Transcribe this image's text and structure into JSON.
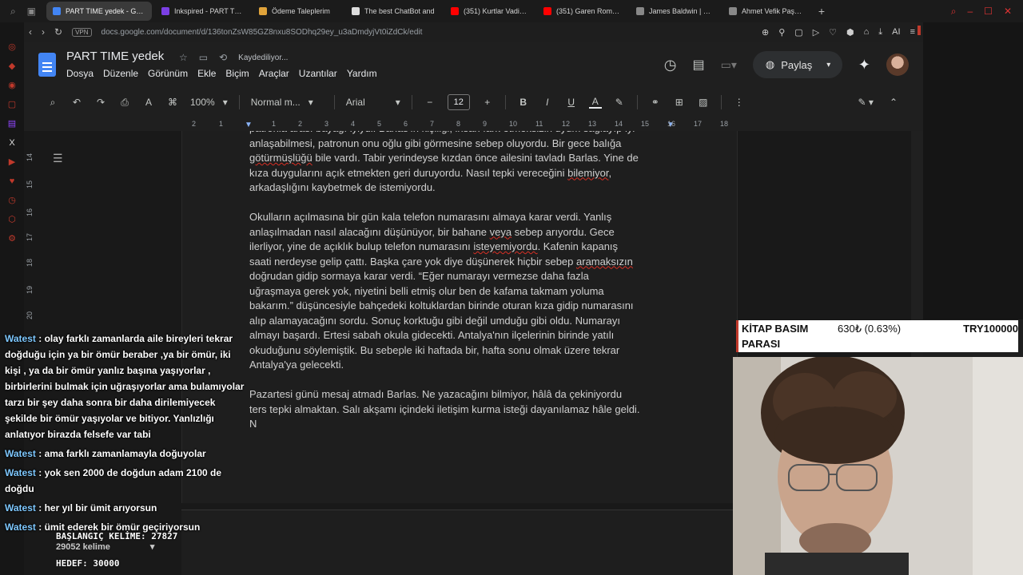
{
  "browser": {
    "tabs": [
      {
        "label": "PART TIME yedek - Google",
        "active": true,
        "color": "#4285f4"
      },
      {
        "label": "Inkspired - PART TIME",
        "active": false,
        "color": "#7b3fe4"
      },
      {
        "label": "Ödeme Taleplerim",
        "active": false,
        "color": "#e0a33a"
      },
      {
        "label": "The best ChatBot and",
        "active": false,
        "color": "#dddddd"
      },
      {
        "label": "(351) Kurtlar Vadisi - 7.",
        "active": false,
        "color": "#ff0000"
      },
      {
        "label": "(351) Garen Romanı İnc",
        "active": false,
        "color": "#ff0000"
      },
      {
        "label": "James Baldwin | Her U",
        "active": false,
        "color": "#888888"
      },
      {
        "label": "Ahmet Vefik Paşa Kütü",
        "active": false,
        "color": "#888888"
      }
    ],
    "new_tab": "+",
    "vpn": "VPN",
    "url": "docs.google.com/document/d/136tonZsW85GZ8nxu8SODhq29ey_u3aDmdyjVt0iZdCk/edit",
    "ai_label": "AI"
  },
  "docs": {
    "title": "PART TIME  yedek",
    "saving": "Kaydediliyor...",
    "menu": [
      "Dosya",
      "Düzenle",
      "Görünüm",
      "Ekle",
      "Biçim",
      "Araçlar",
      "Uzantılar",
      "Yardım"
    ],
    "share": "Paylaş",
    "zoom": "100%",
    "style": "Normal m...",
    "font": "Arial",
    "font_size": "12",
    "ruler_numbers": [
      "2",
      "1",
      "1",
      "2",
      "3",
      "4",
      "5",
      "6",
      "7",
      "8",
      "9",
      "10",
      "11",
      "12",
      "13",
      "14",
      "15",
      "16",
      "17",
      "18"
    ],
    "vruler_numbers": [
      "14",
      "15",
      "16",
      "17",
      "18",
      "19",
      "20"
    ],
    "paragraphs": [
      {
        "lines": [
          "patronla arası bayağı iyiydi. Barlas'ın kişiliği, insan fark etmeksizin uyum sağlayıp iyi",
          "anlaşabilmesi, patronun onu oğlu gibi görmesine sebep oluyordu. Bir gece balığa",
          "götürmüşlüğü bile vardı. Tabir yerindeyse kızdan önce ailesini tavladı Barlas. Yine de",
          "kıza duygularını açık etmekten geri duruyordu. Nasıl tepki vereceğini bilemiyor,",
          "arkadaşlığını kaybetmek de istemiyordu."
        ]
      },
      {
        "lines": [
          "Okulların açılmasına bir gün kala telefon numarasını almaya karar verdi. Yanlış",
          "anlaşılmadan nasıl alacağını düşünüyor, bir bahane veya sebep arıyordu. Gece",
          "ilerliyor, yine de açıklık bulup telefon numarasını isteyemiyordu. Kafenin kapanış",
          "saati nerdeyse gelip çattı. Başka çare yok diye düşünerek hiçbir sebep aramaksızın",
          "doğrudan gidip sormaya karar verdi. “Eğer numarayı vermezse daha fazla",
          "uğraşmaya gerek yok, niyetini belli etmiş olur ben de kafama takmam yoluma",
          "bakarım.” düşüncesiyle bahçedeki koltuklardan birinde oturan kıza gidip numarasını",
          "alıp alamayacağını sordu. Sonuç korktuğu gibi değil umduğu gibi oldu. Numarayı",
          "almayı başardı. Ertesi sabah okula gidecekti. Antalya'nın ilçelerinin birinde yatılı",
          "okuduğunu söylemiştik. Bu sebeple iki haftada bir, hafta sonu olmak üzere tekrar",
          "Antalya'ya gelecekti."
        ]
      },
      {
        "lines": [
          "Pazartesi günü mesaj atmadı Barlas. Ne yazacağını bilmiyor, hâlâ da çekiniyordu",
          "ters tepki almaktan. Salı akşamı içindeki iletişim kurma isteği dayanılamaz hâle geldi.",
          "N"
        ]
      }
    ],
    "word_count": "29052 kelime"
  },
  "chat": {
    "messages": [
      {
        "user": "Watest",
        "text": "olay farklı zamanlarda aile bireyleri tekrar doğduğu için ya bir ömür beraber ,ya bir ömür, iki kişi , ya da bir ömür yanlız başına yaşıyorlar , birbirlerini bulmak için uğraşıyorlar ama bulamıyolar tarzı bir şey daha sonra bir daha dirilemiyecek şekilde bir ömür yaşıyolar ve bitiyor. Yanlızlığı anlatıyor birazda felsefe var tabi"
      },
      {
        "user": "Watest",
        "text": "ama farklı zamanlamayla doğuyolar"
      },
      {
        "user": "Watest",
        "text": "yok sen 2000 de doğdun adam 2100 de doğdu"
      },
      {
        "user": "Watest",
        "text": "her yıl bir ümit arıyorsun"
      },
      {
        "user": "Watest",
        "text": "ümit ederek bir ömür geçiriyorsun"
      }
    ]
  },
  "counter": {
    "start": "BAŞLANGIÇ KELİME: 27827",
    "target": "HEDEF: 30000"
  },
  "ticker": {
    "name": "KİTAP BASIM",
    "name2": "PARASI",
    "price": "630₺ (0.63%)",
    "target": "TRY100000"
  }
}
